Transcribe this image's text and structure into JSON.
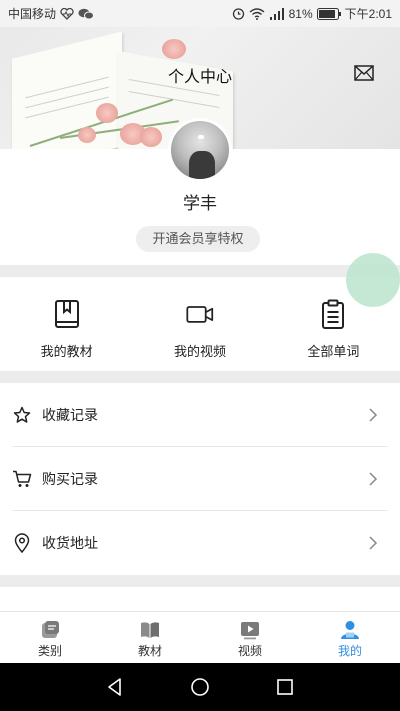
{
  "status_bar": {
    "carrier": "中国移动",
    "battery": "81%",
    "time": "下午2:01"
  },
  "header": {
    "title": "个人中心",
    "mail_icon": "mail-icon"
  },
  "profile": {
    "username": "学丰",
    "vip_button": "开通会员享特权"
  },
  "features": [
    {
      "label": "我的教材",
      "icon": "textbook-icon"
    },
    {
      "label": "我的视频",
      "icon": "video-camera-icon"
    },
    {
      "label": "全部单词",
      "icon": "clipboard-icon"
    }
  ],
  "menu": [
    {
      "label": "收藏记录",
      "icon": "star-icon"
    },
    {
      "label": "购买记录",
      "icon": "cart-icon"
    },
    {
      "label": "收货地址",
      "icon": "location-pin-icon"
    }
  ],
  "tabs": [
    {
      "label": "类别",
      "icon": "category-icon",
      "active": false
    },
    {
      "label": "教材",
      "icon": "book-icon",
      "active": false
    },
    {
      "label": "视频",
      "icon": "video-play-icon",
      "active": false
    },
    {
      "label": "我的",
      "icon": "user-icon",
      "active": true
    }
  ],
  "colors": {
    "accent": "#2f8fe0",
    "float_circle": "#bfe5cf",
    "page_background": "#ececec"
  }
}
